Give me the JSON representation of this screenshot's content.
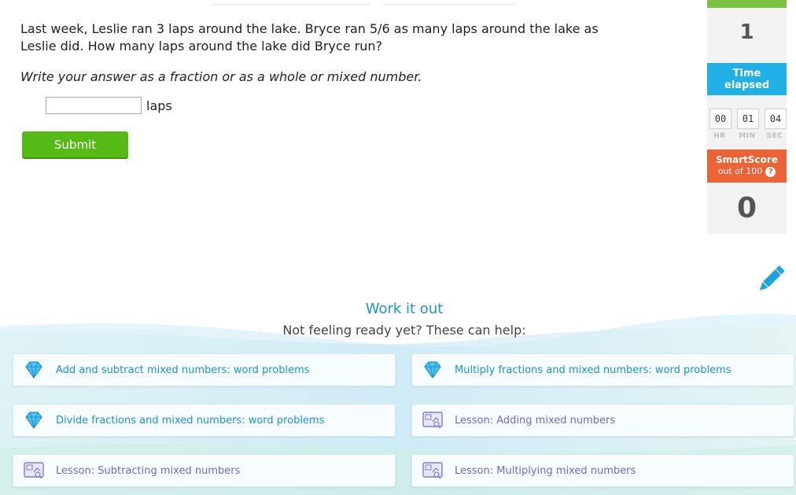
{
  "question": {
    "text": "Last week, Leslie ran 3 laps around the lake. Bryce ran 5/6 as many laps around the lake as Leslie did. How many laps around the lake did Bryce run?",
    "instruction": "Write your answer as a fraction or as a whole or mixed number.",
    "answer_value": "",
    "unit": "laps",
    "submit_label": "Submit"
  },
  "sidebar": {
    "answered_value": "1",
    "time_label": "Time elapsed",
    "timer": [
      {
        "value": "00",
        "label": "HR"
      },
      {
        "value": "01",
        "label": "MIN"
      },
      {
        "value": "04",
        "label": "SEC"
      }
    ],
    "smartscore_title": "SmartScore",
    "smartscore_sub": "out of 100",
    "smartscore_help": "?",
    "smartscore_value": "0"
  },
  "help": {
    "title": "Work it out",
    "subtitle": "Not feeling ready yet? These can help:",
    "items": [
      {
        "label": "Add and subtract mixed numbers: word problems",
        "icon": "diamond-icon"
      },
      {
        "label": "Multiply fractions and mixed numbers: word problems",
        "icon": "diamond-icon"
      },
      {
        "label": "Divide fractions and mixed numbers: word problems",
        "icon": "diamond-icon"
      },
      {
        "label": "Lesson: Adding mixed numbers",
        "icon": "lesson-icon"
      },
      {
        "label": "Lesson: Subtracting mixed numbers",
        "icon": "lesson-icon"
      },
      {
        "label": "Lesson: Multiplying mixed numbers",
        "icon": "lesson-icon"
      }
    ]
  },
  "colors": {
    "submit": "#55b916",
    "time_header": "#1fb0e6",
    "smartscore_header": "#ec6336",
    "link": "#1b93d0",
    "lesson_link": "#6b6bd0"
  }
}
